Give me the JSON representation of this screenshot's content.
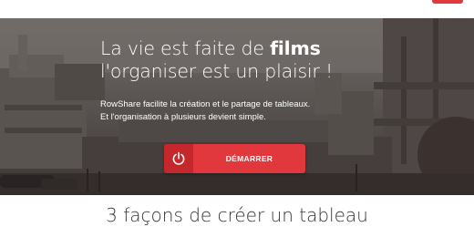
{
  "colors": {
    "brand_red": "#e0383c",
    "brand_red_dark": "#c4282c",
    "hero_text": "#ffffff",
    "section_title": "#333333"
  },
  "hero": {
    "headline_line1_prefix": "La vie est faite de ",
    "headline_line1_bold": "films",
    "headline_line2": "l'organiser est un plaisir !",
    "subtext_line1": "RowShare facilite la création et le partage de tableaux.",
    "subtext_line2": "Et l'organisation à plusieurs devient simple.",
    "cta": {
      "icon": "power-icon",
      "label": "DÉMARRER"
    }
  },
  "section": {
    "title": "3 façons de créer un tableau"
  }
}
